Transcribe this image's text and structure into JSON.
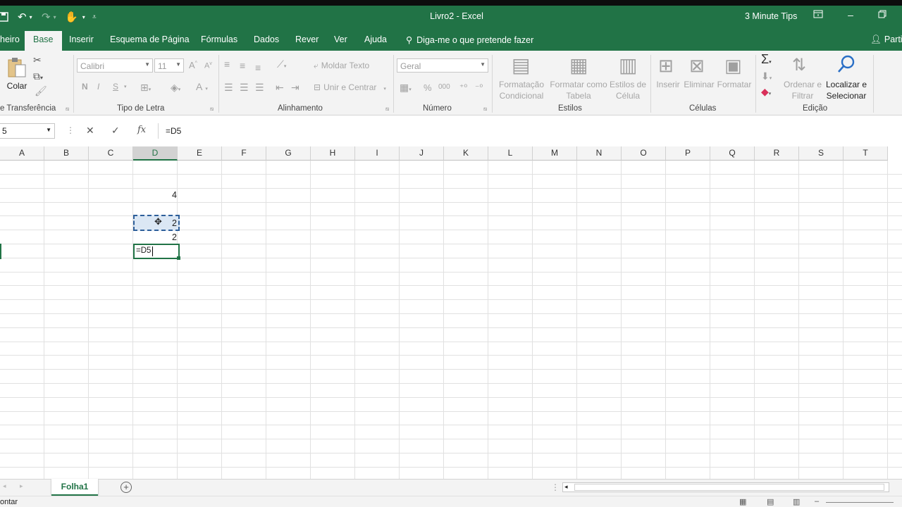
{
  "window": {
    "title": "Livro2  -  Excel",
    "user": "3 Minute Tips",
    "brand_color": "#217346"
  },
  "quick_access": {
    "icons": [
      "save-icon",
      "undo-icon",
      "redo-icon",
      "touch-mode-icon",
      "customize-icon"
    ]
  },
  "tabs": [
    {
      "label": "heiro",
      "active": false
    },
    {
      "label": "Base",
      "active": true
    },
    {
      "label": "Inserir",
      "active": false
    },
    {
      "label": "Esquema de Página",
      "active": false
    },
    {
      "label": "Fórmulas",
      "active": false
    },
    {
      "label": "Dados",
      "active": false
    },
    {
      "label": "Rever",
      "active": false
    },
    {
      "label": "Ver",
      "active": false
    },
    {
      "label": "Ajuda",
      "active": false
    }
  ],
  "tell_me": "Diga-me o que pretende fazer",
  "share": "Partil",
  "ribbon": {
    "clipboard": {
      "paste_label": "Colar",
      "group_label": "e Transferência"
    },
    "font": {
      "font_name": "Calibri",
      "font_size": "11",
      "bold": "N",
      "italic": "I",
      "underline": "S",
      "grow": "A",
      "shrink": "A",
      "font_color": "A",
      "group_label": "Tipo de Letra"
    },
    "alignment": {
      "wrap_text": "Moldar Texto",
      "merge_center": "Unir e Centrar",
      "group_label": "Alinhamento"
    },
    "number": {
      "format": "Geral",
      "percent": "%",
      "thousands": "000",
      "group_label": "Número"
    },
    "styles": {
      "conditional_1": "Formatação",
      "conditional_2": "Condicional",
      "table_1": "Formatar como",
      "table_2": "Tabela",
      "cell_1": "Estilos de",
      "cell_2": "Célula",
      "group_label": "Estilos"
    },
    "cells": {
      "insert": "Inserir",
      "delete": "Eliminar",
      "format": "Formatar",
      "group_label": "Células"
    },
    "editing": {
      "sort_1": "Ordenar e",
      "sort_2": "Filtrar",
      "find_1": "Localizar e",
      "find_2": "Selecionar",
      "group_label": "Edição"
    }
  },
  "formula_bar": {
    "name_box": "5",
    "cancel": "✕",
    "enter": "✓",
    "fx": "fx",
    "formula": "=D5"
  },
  "grid": {
    "columns": [
      "A",
      "B",
      "C",
      "D",
      "E",
      "F",
      "G",
      "H",
      "I",
      "J",
      "K",
      "L",
      "M",
      "N",
      "O",
      "P",
      "Q",
      "R",
      "S",
      "T"
    ],
    "selected_column": "D",
    "cells": [
      {
        "ref": "D3",
        "value": "4"
      },
      {
        "ref": "D5",
        "value": "2"
      },
      {
        "ref": "D6",
        "value": "2"
      },
      {
        "ref": "D7",
        "value": "=D5"
      }
    ]
  },
  "sheet_tabs": [
    {
      "label": "Folha1",
      "active": true
    }
  ],
  "status": {
    "mode": "ontar"
  }
}
